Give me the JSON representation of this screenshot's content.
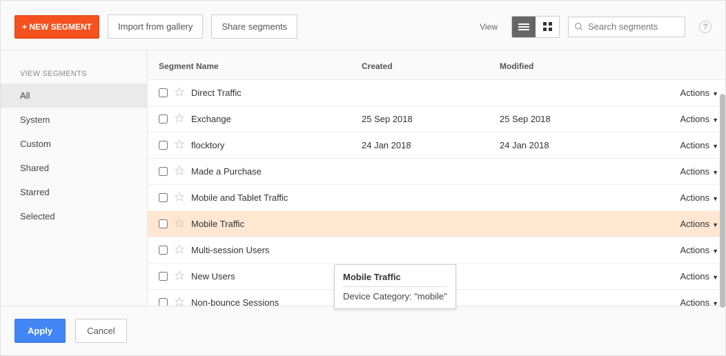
{
  "topbar": {
    "new_segment": "+ NEW SEGMENT",
    "import": "Import from gallery",
    "share": "Share segments",
    "view_label": "View",
    "search_placeholder": "Search segments"
  },
  "sidebar": {
    "title": "VIEW SEGMENTS",
    "items": [
      "All",
      "System",
      "Custom",
      "Shared",
      "Starred",
      "Selected"
    ]
  },
  "table": {
    "headers": {
      "name": "Segment Name",
      "created": "Created",
      "modified": "Modified"
    },
    "actions_label": "Actions",
    "rows": [
      {
        "name": "Direct Traffic",
        "created": "",
        "modified": ""
      },
      {
        "name": "Exchange",
        "created": "25 Sep 2018",
        "modified": "25 Sep 2018"
      },
      {
        "name": "flocktory",
        "created": "24 Jan 2018",
        "modified": "24 Jan 2018"
      },
      {
        "name": "Made a Purchase",
        "created": "",
        "modified": ""
      },
      {
        "name": "Mobile and Tablet Traffic",
        "created": "",
        "modified": ""
      },
      {
        "name": "Mobile Traffic",
        "created": "",
        "modified": ""
      },
      {
        "name": "Multi-session Users",
        "created": "",
        "modified": ""
      },
      {
        "name": "New Users",
        "created": "",
        "modified": ""
      },
      {
        "name": "Non-bounce Sessions",
        "created": "",
        "modified": ""
      }
    ]
  },
  "tooltip": {
    "title": "Mobile Traffic",
    "body": "Device Category: \"mobile\""
  },
  "footer": {
    "apply": "Apply",
    "cancel": "Cancel"
  }
}
